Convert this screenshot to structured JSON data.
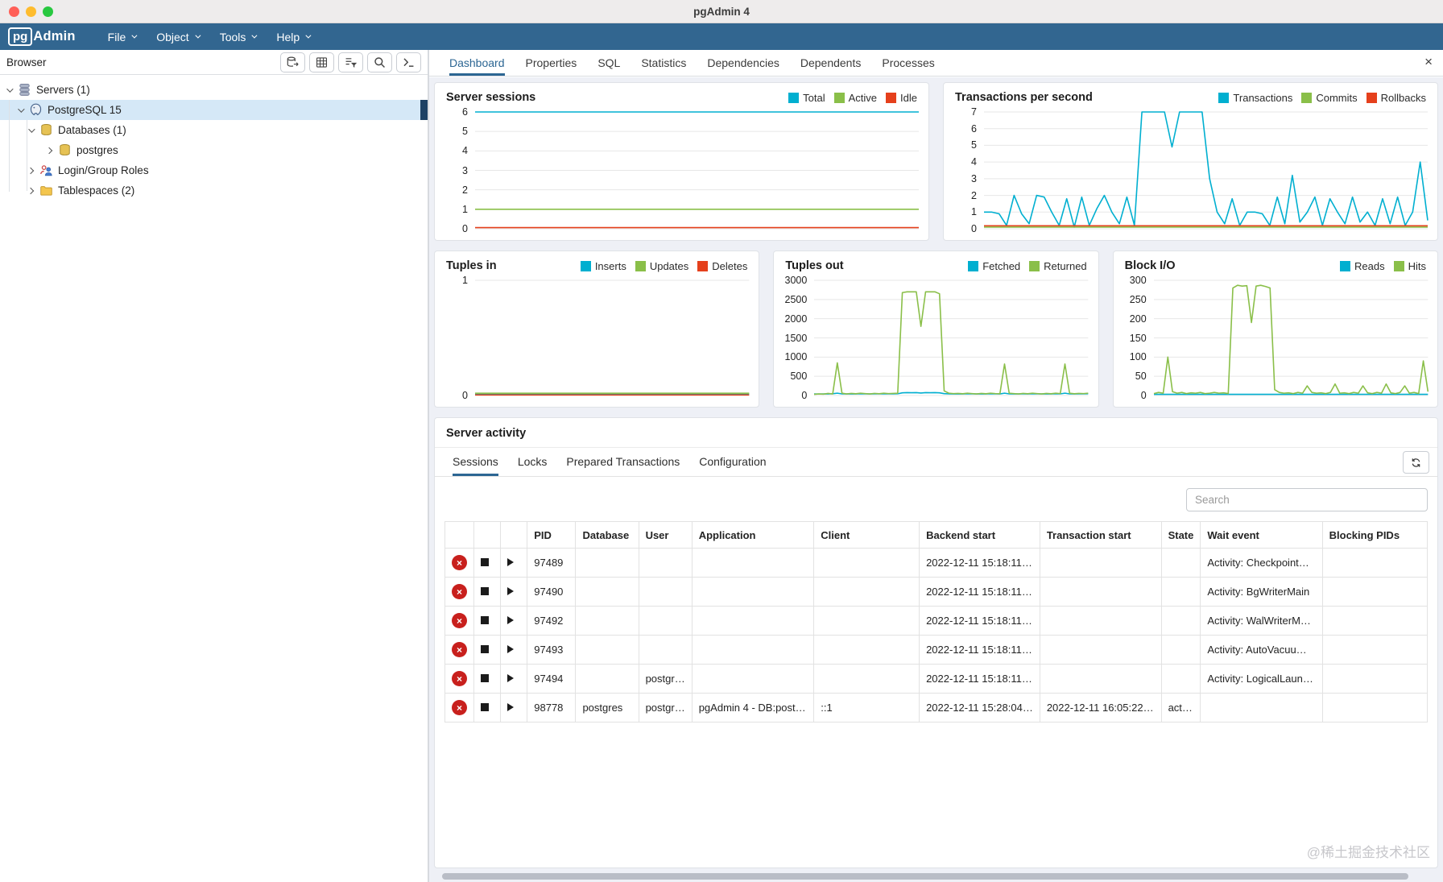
{
  "theme": {
    "navbar": "#326690",
    "accent": "#2c6693",
    "selection": "#d5e8f7",
    "chart_cyan": "#00afd0",
    "chart_green": "#8abf49",
    "chart_red": "#e5401c",
    "traffic_red": "#ff5f57",
    "traffic_yellow": "#febc2e",
    "traffic_green": "#28c840"
  },
  "window": {
    "title": "pgAdmin 4"
  },
  "navbar": {
    "logo_pg": "pg",
    "logo_admin": "Admin",
    "menus": [
      {
        "label": "File"
      },
      {
        "label": "Object"
      },
      {
        "label": "Tools"
      },
      {
        "label": "Help"
      }
    ]
  },
  "browser": {
    "title": "Browser",
    "toolbar": [
      {
        "name": "connections-button",
        "icon": "database-arrow-icon"
      },
      {
        "name": "properties-grid-button",
        "icon": "grid-icon"
      },
      {
        "name": "filter-button",
        "icon": "filter-grid-icon"
      },
      {
        "name": "search-button",
        "icon": "search-icon"
      },
      {
        "name": "query-tool-button",
        "icon": "terminal-icon"
      }
    ],
    "tree": [
      {
        "label": "Servers (1)",
        "level": 0,
        "expanded": true,
        "selected": false,
        "icon": "server-stack-icon"
      },
      {
        "label": "PostgreSQL 15",
        "level": 1,
        "expanded": true,
        "selected": true,
        "icon": "postgresql-elephant-icon"
      },
      {
        "label": "Databases (1)",
        "level": 2,
        "expanded": true,
        "selected": false,
        "icon": "database-gold-icon"
      },
      {
        "label": "postgres",
        "level": 3,
        "expanded": false,
        "selected": false,
        "icon": "database-gold-icon"
      },
      {
        "label": "Login/Group Roles",
        "level": 2,
        "expanded": false,
        "selected": false,
        "icon": "users-icon"
      },
      {
        "label": "Tablespaces (2)",
        "level": 2,
        "expanded": false,
        "selected": false,
        "icon": "folder-icon"
      }
    ]
  },
  "main_tabs": [
    {
      "label": "Dashboard",
      "active": true
    },
    {
      "label": "Properties",
      "active": false
    },
    {
      "label": "SQL",
      "active": false
    },
    {
      "label": "Statistics",
      "active": false
    },
    {
      "label": "Dependencies",
      "active": false
    },
    {
      "label": "Dependents",
      "active": false
    },
    {
      "label": "Processes",
      "active": false
    }
  ],
  "chart_data": [
    {
      "type": "line",
      "title": "Server sessions",
      "ylim": [
        0,
        6
      ],
      "yticks": [
        6,
        5,
        4,
        3,
        2,
        1,
        0
      ],
      "row": 1,
      "series": [
        {
          "name": "Total",
          "color": "#00afd0",
          "values": [
            6,
            6
          ]
        },
        {
          "name": "Active",
          "color": "#8abf49",
          "values": [
            1,
            1
          ]
        },
        {
          "name": "Idle",
          "color": "#e5401c",
          "values": [
            0.06,
            0.06
          ]
        }
      ]
    },
    {
      "type": "line",
      "title": "Transactions per second",
      "ylim": [
        0,
        7
      ],
      "yticks": [
        7,
        6,
        5,
        4,
        3,
        2,
        1,
        0
      ],
      "row": 1,
      "series": [
        {
          "name": "Transactions",
          "color": "#00afd0",
          "values": [
            1,
            1,
            0.9,
            0.2,
            2,
            0.9,
            0.3,
            2,
            1.9,
            1,
            0.2,
            1.8,
            0.1,
            1.9,
            0.2,
            1.2,
            2,
            1,
            0.3,
            1.9,
            0.2,
            7,
            7,
            7,
            7,
            4.9,
            7,
            7,
            7,
            7,
            3,
            1,
            0.3,
            1.8,
            0.2,
            1,
            1,
            0.9,
            0.2,
            1.9,
            0.3,
            3.2,
            0.4,
            1,
            1.9,
            0.2,
            1.8,
            1,
            0.3,
            1.9,
            0.4,
            1,
            0.2,
            1.8,
            0.3,
            1.9,
            0.2,
            1,
            4,
            0.5
          ]
        },
        {
          "name": "Commits",
          "color": "#8abf49",
          "values": [
            0.1,
            0.1
          ]
        },
        {
          "name": "Rollbacks",
          "color": "#e5401c",
          "values": [
            0.18,
            0.18
          ]
        }
      ]
    },
    {
      "type": "line",
      "title": "Tuples in",
      "ylim": [
        0,
        1
      ],
      "yticks": [
        1,
        0
      ],
      "row": 2,
      "series": [
        {
          "name": "Inserts",
          "color": "#00afd0",
          "values": [
            0.012,
            0.012
          ]
        },
        {
          "name": "Updates",
          "color": "#8abf49",
          "values": [
            0.02,
            0.02
          ]
        },
        {
          "name": "Deletes",
          "color": "#e5401c",
          "values": [
            0.005,
            0.005
          ]
        }
      ]
    },
    {
      "type": "line",
      "title": "Tuples out",
      "ylim": [
        0,
        3000
      ],
      "yticks": [
        3000,
        2500,
        2000,
        1500,
        1000,
        500,
        0
      ],
      "row": 2,
      "series": [
        {
          "name": "Fetched",
          "color": "#00afd0",
          "values": [
            40,
            38,
            42,
            40,
            45,
            60,
            42,
            40,
            44,
            41,
            45,
            42,
            40,
            44,
            42,
            45,
            42,
            44,
            45,
            70,
            75,
            72,
            74,
            65,
            74,
            72,
            75,
            70,
            48,
            42,
            41,
            44,
            40,
            45,
            42,
            40,
            44,
            41,
            45,
            42,
            40,
            60,
            42,
            41,
            40,
            44,
            41,
            45,
            42,
            40,
            44,
            41,
            45,
            42,
            60,
            42,
            40,
            44,
            42,
            45
          ]
        },
        {
          "name": "Returned",
          "color": "#8abf49",
          "values": [
            30,
            40,
            35,
            55,
            40,
            850,
            60,
            40,
            55,
            45,
            60,
            50,
            40,
            55,
            45,
            60,
            50,
            55,
            60,
            2680,
            2700,
            2700,
            2700,
            1800,
            2700,
            2700,
            2700,
            2650,
            120,
            60,
            50,
            55,
            45,
            60,
            50,
            40,
            55,
            45,
            60,
            50,
            45,
            820,
            60,
            50,
            40,
            55,
            45,
            60,
            50,
            40,
            55,
            45,
            60,
            50,
            820,
            60,
            45,
            55,
            50,
            60
          ]
        }
      ]
    },
    {
      "type": "line",
      "title": "Block I/O",
      "ylim": [
        0,
        300
      ],
      "yticks": [
        300,
        250,
        200,
        150,
        100,
        50,
        0
      ],
      "row": 2,
      "series": [
        {
          "name": "Reads",
          "color": "#00afd0",
          "values": [
            3,
            3
          ]
        },
        {
          "name": "Hits",
          "color": "#8abf49",
          "values": [
            5,
            8,
            6,
            100,
            10,
            6,
            8,
            5,
            7,
            6,
            8,
            5,
            6,
            8,
            6,
            7,
            5,
            280,
            287,
            285,
            286,
            190,
            285,
            287,
            284,
            280,
            15,
            8,
            6,
            7,
            5,
            8,
            6,
            25,
            8,
            6,
            7,
            5,
            8,
            30,
            6,
            7,
            5,
            8,
            6,
            25,
            7,
            5,
            8,
            6,
            30,
            7,
            5,
            8,
            25,
            6,
            8,
            5,
            90,
            10
          ]
        }
      ]
    }
  ],
  "server_activity": {
    "title": "Server activity",
    "tabs": [
      {
        "label": "Sessions",
        "active": true
      },
      {
        "label": "Locks",
        "active": false
      },
      {
        "label": "Prepared Transactions",
        "active": false
      },
      {
        "label": "Configuration",
        "active": false
      }
    ],
    "search_placeholder": "Search",
    "table": {
      "columns": [
        "PID",
        "Database",
        "User",
        "Application",
        "Client",
        "Backend start",
        "Transaction start",
        "State",
        "Wait event",
        "Blocking PIDs"
      ],
      "rows": [
        [
          "97489",
          "",
          "",
          "",
          "",
          "2022-12-11 15:18:11…",
          "",
          "",
          "Activity: Checkpoint…",
          ""
        ],
        [
          "97490",
          "",
          "",
          "",
          "",
          "2022-12-11 15:18:11…",
          "",
          "",
          "Activity: BgWriterMain",
          ""
        ],
        [
          "97492",
          "",
          "",
          "",
          "",
          "2022-12-11 15:18:11…",
          "",
          "",
          "Activity: WalWriterM…",
          ""
        ],
        [
          "97493",
          "",
          "",
          "",
          "",
          "2022-12-11 15:18:11…",
          "",
          "",
          "Activity: AutoVacuu…",
          ""
        ],
        [
          "97494",
          "",
          "postgr…",
          "",
          "",
          "2022-12-11 15:18:11…",
          "",
          "",
          "Activity: LogicalLaun…",
          ""
        ],
        [
          "98778",
          "postgres",
          "postgr…",
          "pgAdmin 4 - DB:post…",
          "::1",
          "2022-12-11 15:28:04…",
          "2022-12-11 16:05:22…",
          "act…",
          "",
          ""
        ]
      ]
    }
  },
  "watermark": "@稀土掘金技术社区"
}
